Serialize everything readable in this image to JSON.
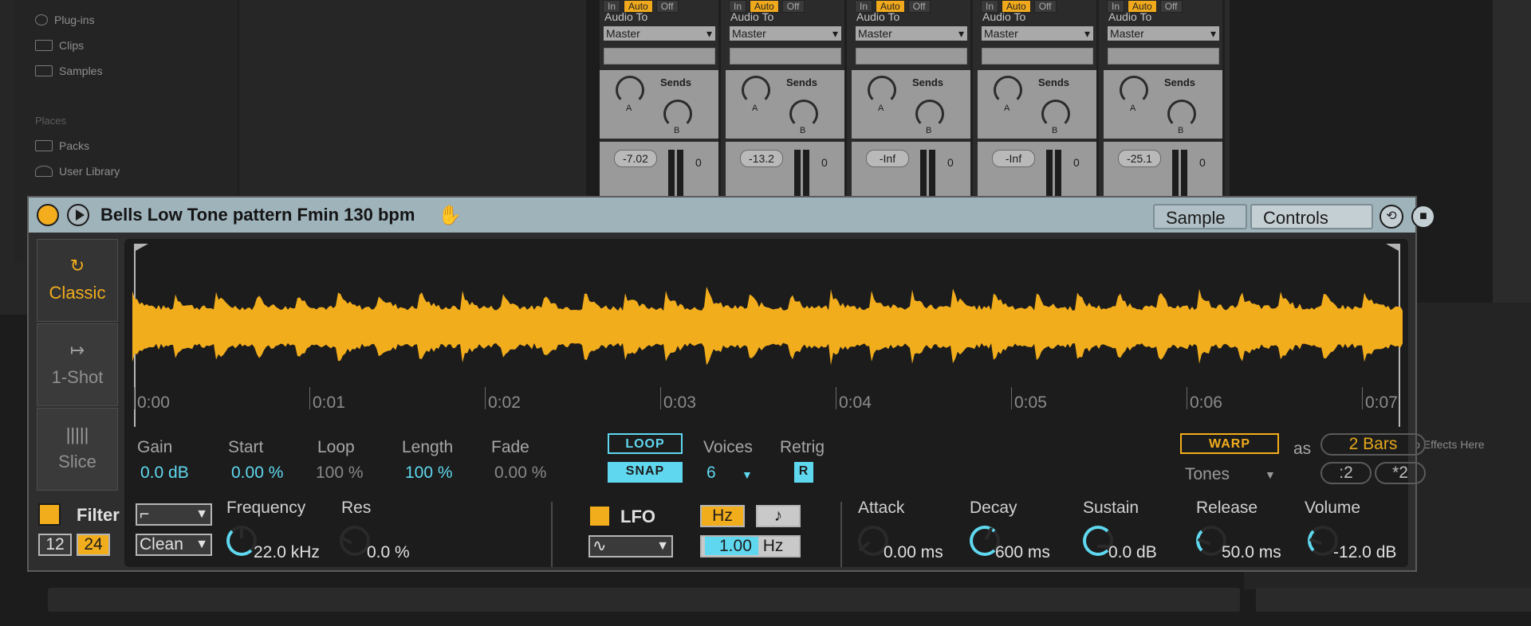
{
  "browser": {
    "items": [
      {
        "label": "Plug-ins",
        "icon": "plug-icon"
      },
      {
        "label": "Clips",
        "icon": "clip-icon"
      },
      {
        "label": "Samples",
        "icon": "waveform-icon"
      }
    ],
    "places_heading": "Places",
    "places": [
      {
        "label": "Packs",
        "icon": "packs-icon"
      },
      {
        "label": "User Library",
        "icon": "user-icon"
      }
    ]
  },
  "mixer": {
    "strips": [
      {
        "monitor": [
          "In",
          "Auto",
          "Off"
        ],
        "audio_to": "Audio To",
        "route": "Master",
        "sends": "Sends",
        "volume": "-7.02",
        "peak": "0"
      },
      {
        "monitor": [
          "In",
          "Auto",
          "Off"
        ],
        "audio_to": "Audio To",
        "route": "Master",
        "sends": "Sends",
        "volume": "-13.2",
        "peak": "0"
      },
      {
        "monitor": [
          "In",
          "Auto",
          "Off"
        ],
        "audio_to": "Audio To",
        "route": "Master",
        "sends": "Sends",
        "volume": "-Inf",
        "peak": "0"
      },
      {
        "monitor": [
          "In",
          "Auto",
          "Off"
        ],
        "audio_to": "Audio To",
        "route": "Master",
        "sends": "Sends",
        "volume": "-Inf",
        "peak": "0"
      },
      {
        "monitor": [
          "In",
          "Auto",
          "Off"
        ],
        "audio_to": "Audio To",
        "route": "Master",
        "sends": "Sends",
        "volume": "-25.1",
        "peak": "0"
      }
    ],
    "send_a": "A",
    "send_b": "B",
    "audio_effects_hint": "io Effects Here"
  },
  "device": {
    "title": "Bells Low Tone pattern Fmin 130 bpm",
    "tabs": {
      "sample": "Sample",
      "controls": "Controls"
    },
    "modes": [
      {
        "label": "Classic",
        "icon": "loop-icon",
        "active": true
      },
      {
        "label": "1-Shot",
        "icon": "arrow-right-bar-icon",
        "active": false
      },
      {
        "label": "Slice",
        "icon": "slice-icon",
        "active": false
      }
    ],
    "timeline": [
      "0:00",
      "0:01",
      "0:02",
      "0:03",
      "0:04",
      "0:05",
      "0:06",
      "0:07"
    ],
    "params": [
      {
        "label": "Gain",
        "value": "0.0 dB",
        "active": true
      },
      {
        "label": "Start",
        "value": "0.00 %",
        "active": true
      },
      {
        "label": "Loop",
        "value": "100 %",
        "active": false
      },
      {
        "label": "Length",
        "value": "100 %",
        "active": true
      },
      {
        "label": "Fade",
        "value": "0.00 %",
        "active": false
      }
    ],
    "loop_label": "LOOP",
    "snap_label": "SNAP",
    "voices_label": "Voices",
    "voices_value": "6",
    "retrig_label": "Retrig",
    "retrig_value": "R",
    "warp_label": "WARP",
    "as_label": "as",
    "bars_value": "2 Bars",
    "warp_mode": "Tones",
    "half_label": ":2",
    "double_label": "*2",
    "colors": {
      "accent": "#f2ad1c",
      "cyan": "#5fd8ef",
      "title_bar": "#9fb3bb"
    }
  },
  "filter": {
    "label": "Filter",
    "slope_12": "12",
    "slope_24": "24",
    "circuit": "Clean",
    "frequency_label": "Frequency",
    "frequency_value": "22.0 kHz",
    "res_label": "Res",
    "res_value": "0.0 %"
  },
  "lfo": {
    "label": "LFO",
    "hz_label": "Hz",
    "note_label": "♪",
    "rate_value": "1.00",
    "rate_unit": "Hz"
  },
  "envelope": [
    {
      "label": "Attack",
      "value": "0.00 ms"
    },
    {
      "label": "Decay",
      "value": "600 ms"
    },
    {
      "label": "Sustain",
      "value": "0.0 dB"
    },
    {
      "label": "Release",
      "value": "50.0 ms"
    },
    {
      "label": "Volume",
      "value": "-12.0 dB"
    }
  ]
}
